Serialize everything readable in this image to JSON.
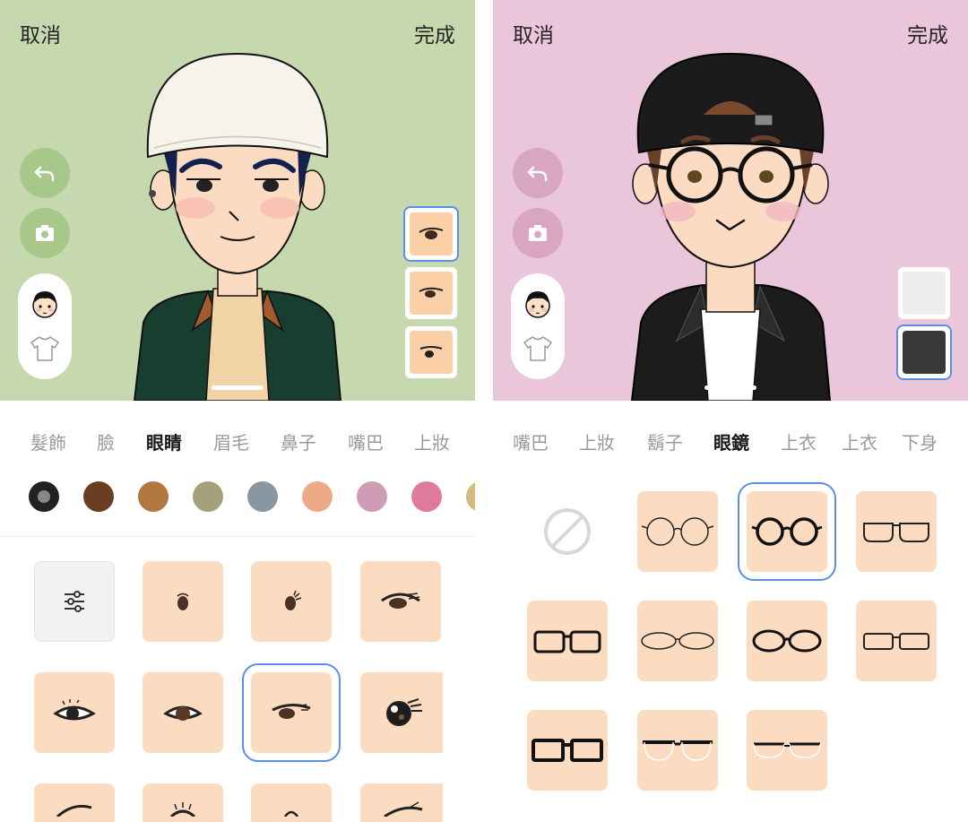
{
  "left": {
    "cancel_label": "取消",
    "done_label": "完成",
    "tabs": [
      "髮飾",
      "臉",
      "眼睛",
      "眉毛",
      "鼻子",
      "嘴巴",
      "上妝"
    ],
    "active_tab": "眼睛",
    "colors": [
      "#222222",
      "#6b3d22",
      "#b0773f",
      "#a3a07c",
      "#8897a2",
      "#eeaa87",
      "#cf9cb5",
      "#de7b9a",
      "#d8b87d"
    ],
    "selected_color_index": 0,
    "swatch_colors": [
      "#fcd0a7",
      "#fcd0a7",
      "#fcd0a7"
    ],
    "selected_swatch_index": 0
  },
  "right": {
    "cancel_label": "取消",
    "done_label": "完成",
    "tabs": [
      "嘴巴",
      "上妝",
      "鬍子",
      "眼鏡",
      "上衣",
      "上衣",
      "下身"
    ],
    "active_tab": "眼鏡",
    "swatch_colors": [
      "#eeeeee",
      "#383838"
    ],
    "selected_swatch_index": 1
  },
  "icons": {
    "undo": "undo-icon",
    "camera": "camera-icon",
    "face_mode": "face-avatar-icon",
    "clothes_mode": "shirt-icon",
    "adjust": "sliders-icon",
    "none": "none-icon"
  }
}
